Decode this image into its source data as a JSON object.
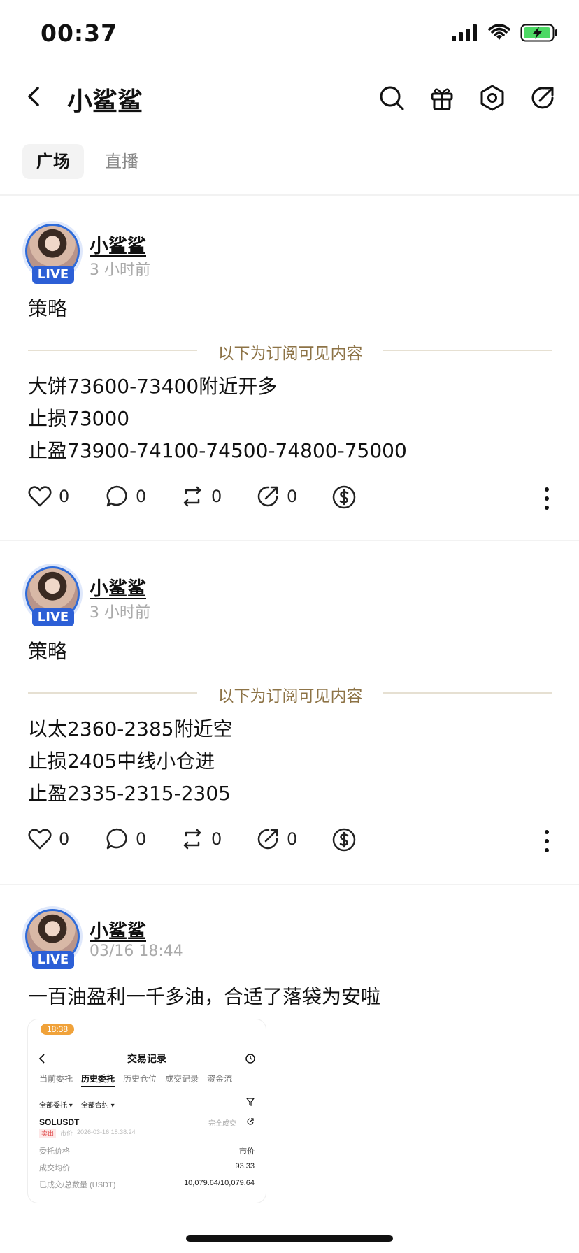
{
  "status_bar": {
    "time": "00:37"
  },
  "header": {
    "title": "小鲨鲨"
  },
  "tabs": [
    {
      "label": "广场",
      "active": true
    },
    {
      "label": "直播",
      "active": false
    }
  ],
  "posts": [
    {
      "author": "小鲨鲨",
      "badge": "LIVE",
      "time": "3 小时前",
      "text": "策略",
      "subscribe_label": "以下为订阅可见内容",
      "lines": [
        "大饼73600-73400附近开多",
        "止损73000",
        "止盈73900-74100-74500-74800-75000"
      ],
      "likes": "0",
      "comments": "0",
      "reposts": "0",
      "shares": "0"
    },
    {
      "author": "小鲨鲨",
      "badge": "LIVE",
      "time": "3 小时前",
      "text": "策略",
      "subscribe_label": "以下为订阅可见内容",
      "lines": [
        "以太2360-2385附近空",
        "止损2405中线小仓进",
        "止盈2335-2315-2305"
      ],
      "likes": "0",
      "comments": "0",
      "reposts": "0",
      "shares": "0"
    },
    {
      "author": "小鲨鲨",
      "badge": "LIVE",
      "time": "03/16 18:44",
      "text": "一百油盈利一千多油，合适了落袋为安啦",
      "screenshot": {
        "time": "18:38",
        "title": "交易记录",
        "tabs": [
          "当前委托",
          "历史委托",
          "历史仓位",
          "成交记录",
          "资金流"
        ],
        "active_tab": "历史委托",
        "filters": [
          "全部委托 ▾",
          "全部合约 ▾"
        ],
        "symbol": "SOLUSDT",
        "status": "完全成交",
        "side_tag": "卖出",
        "order_type": "市价",
        "datetime": "2026-03-16 18:38:24",
        "rows": [
          {
            "label": "委托价格",
            "value": "市价"
          },
          {
            "label": "成交均价",
            "value": "93.33"
          },
          {
            "label": "已成交/总数量 (USDT)",
            "value": "10,079.64/10,079.64"
          }
        ]
      }
    }
  ]
}
